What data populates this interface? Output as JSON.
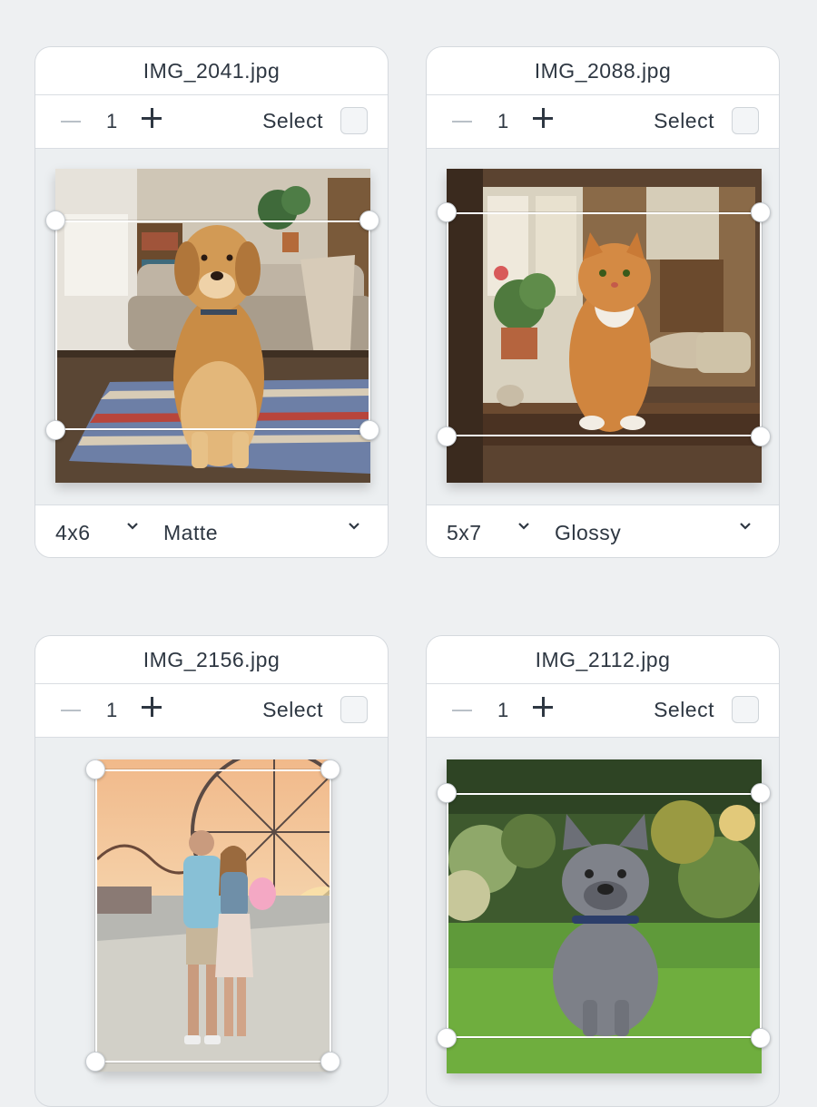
{
  "cards": [
    {
      "filename": "IMG_2041.jpg",
      "quantity": "1",
      "select_label": "Select",
      "size": "4x6",
      "finish": "Matte",
      "photo_alt": "golden retriever sitting on rug in living room"
    },
    {
      "filename": "IMG_2088.jpg",
      "quantity": "1",
      "select_label": "Select",
      "size": "5x7",
      "finish": "Glossy",
      "photo_alt": "orange tabby cat sitting on window sill"
    },
    {
      "filename": "IMG_2156.jpg",
      "quantity": "1",
      "select_label": "Select",
      "photo_alt": "couple at amusement park with ferris wheel"
    },
    {
      "filename": "IMG_2112.jpg",
      "quantity": "1",
      "select_label": "Select",
      "photo_alt": "french bulldog sitting on grass"
    }
  ],
  "colors": {
    "background": "#eef0f2",
    "card_bg": "#ffffff",
    "text": "#2e3742",
    "disabled": "#b9c0c7"
  },
  "icons": {
    "decrement": "minus-icon",
    "increment": "plus-icon",
    "dropdown": "chevron-down-icon",
    "crop_handle": "crop-handle"
  }
}
